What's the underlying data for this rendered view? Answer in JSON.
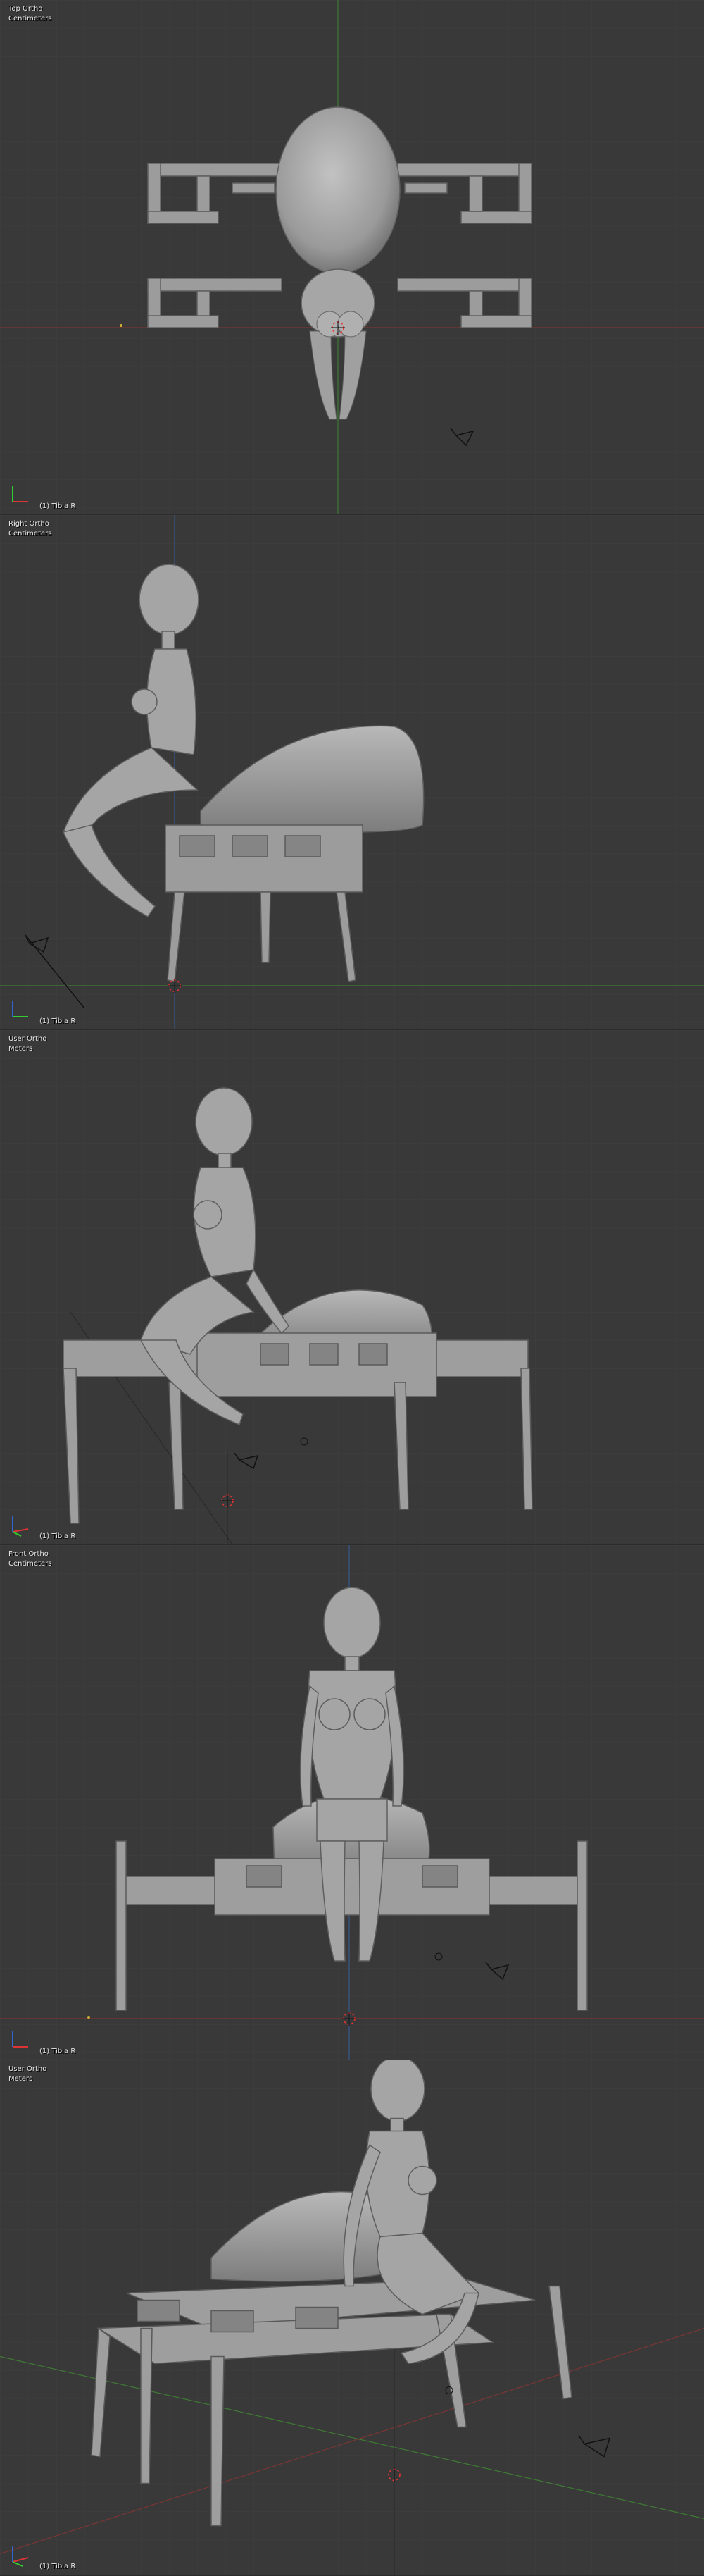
{
  "viewports": [
    {
      "view": "Top Ortho",
      "units": "Centimeters",
      "object": "(1) Tibia R"
    },
    {
      "view": "Right Ortho",
      "units": "Centimeters",
      "object": "(1) Tibia R"
    },
    {
      "view": "User Ortho",
      "units": "Meters",
      "object": "(1) Tibia R"
    },
    {
      "view": "Front Ortho",
      "units": "Centimeters",
      "object": "(1) Tibia R"
    },
    {
      "view": "User Ortho",
      "units": "Meters",
      "object": "(1) Tibia R"
    }
  ],
  "colors": {
    "background": "#393939",
    "grid": "#3f3f3f",
    "x_axis": "#8a3a3a",
    "y_axis": "#4f8a3a",
    "model": "#a8a8a8",
    "model_shadow": "#6e6e6e",
    "hud_text": "#e8e8e8"
  },
  "icons": [
    "axis-gizmo-icon",
    "3d-cursor-icon",
    "camera-icon",
    "lamp-icon"
  ]
}
